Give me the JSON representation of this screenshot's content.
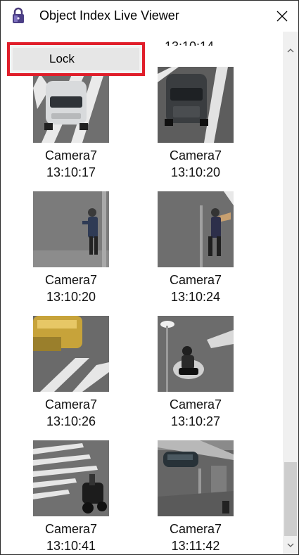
{
  "window": {
    "title": "Object Index Live Viewer",
    "close_symbol": "✕",
    "app_icon": "padlock-icon"
  },
  "context_menu": {
    "items": [
      {
        "label": "Lock"
      }
    ]
  },
  "partial_top_time": "13:10:14",
  "tiles": [
    {
      "camera": "Camera7",
      "time": "13:10:17",
      "scene": "white-car-crosswalk"
    },
    {
      "camera": "Camera7",
      "time": "13:10:20",
      "scene": "dark-car-crosswalk"
    },
    {
      "camera": "Camera7",
      "time": "13:10:20",
      "scene": "person-walking-by-pole"
    },
    {
      "camera": "Camera7",
      "time": "13:10:24",
      "scene": "person-walking-road"
    },
    {
      "camera": "Camera7",
      "time": "13:10:26",
      "scene": "yellow-vehicle-blur"
    },
    {
      "camera": "Camera7",
      "time": "13:10:27",
      "scene": "motorbike-rider"
    },
    {
      "camera": "Camera7",
      "time": "13:10:41",
      "scene": "scooter-crosswalk"
    },
    {
      "camera": "Camera7",
      "time": "13:11:42",
      "scene": "dark-car-street"
    }
  ],
  "scrollbar": {
    "up_arrow": "^",
    "down_arrow": "v"
  },
  "colors": {
    "highlight_border": "#e01e2a",
    "menu_bg": "#f2f2f2",
    "scroll_thumb": "#cdcdcd"
  }
}
